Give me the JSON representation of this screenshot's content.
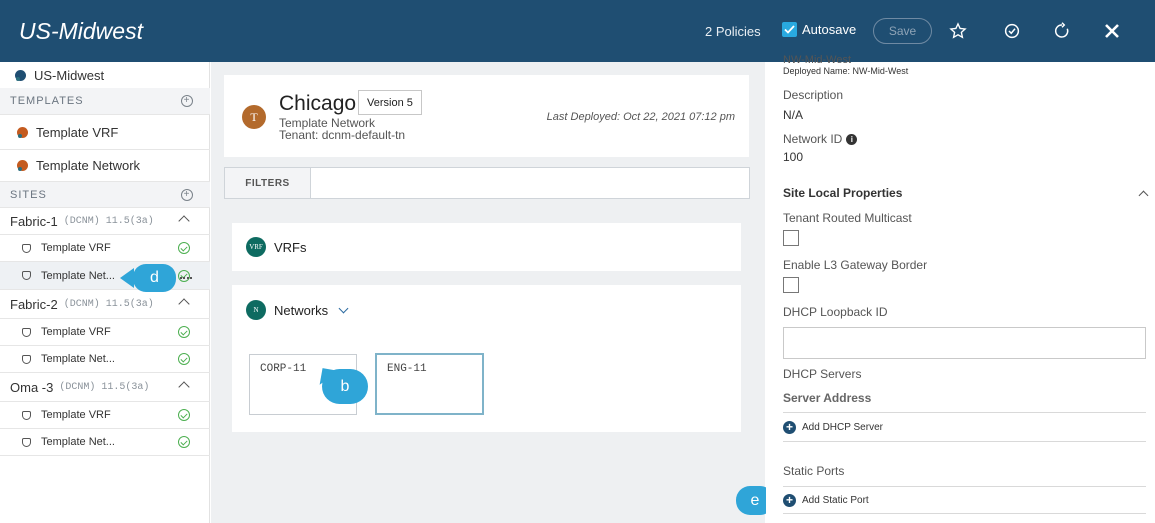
{
  "header": {
    "title": "US-Midwest",
    "policies_label": "2 Policies",
    "autosave_label": "Autosave",
    "save_label": "Save",
    "icons": [
      "checkbox-checked-icon",
      "star-icon",
      "deploy-icon",
      "refresh-icon",
      "close-icon"
    ]
  },
  "sidebar": {
    "schema_name": "US-Midwest",
    "templates_header": "TEMPLATES",
    "templates": [
      {
        "label": "Template VRF"
      },
      {
        "label": "Template Network"
      }
    ],
    "sites_header": "SITES",
    "fabrics": [
      {
        "name": "Fabric-1",
        "version": "(DCNM) 11.5(3a)",
        "items": [
          "Template VRF",
          "Template Net..."
        ]
      },
      {
        "name": "Fabric-2",
        "version": "(DCNM) 11.5(3a)",
        "items": [
          "Template VRF",
          "Template Net..."
        ]
      },
      {
        "name": "Oma -3",
        "version": "(DCNM) 11.5(3a)",
        "items": [
          "Template VRF",
          "Template Net..."
        ]
      }
    ]
  },
  "main": {
    "avatar_letter": "T",
    "template_title": "Chicago",
    "version_badge": "Version 5",
    "template_type": "Template Network",
    "tenant": "Tenant: dcnm-default-tn",
    "last_deployed": "Last Deployed: Oct 22, 2021 07:12 pm",
    "filters_label": "FILTERS",
    "vrfs_badge": "VRF",
    "vrfs_label": "VRFs",
    "networks_badge": "N",
    "networks_label": "Networks",
    "network_tiles": [
      "CORP-11",
      "ENG-11"
    ]
  },
  "callouts": {
    "b": "b",
    "d": "d",
    "e": "e"
  },
  "panel": {
    "top_name_cut": "NW-Mid-West",
    "deployed_name": "Deployed Name: NW-Mid-West",
    "description_label": "Description",
    "description_value": "N/A",
    "network_id_label": "Network ID",
    "network_id_value": "100",
    "site_local_header": "Site Local Properties",
    "tenant_routed_multicast_label": "Tenant Routed Multicast",
    "enable_l3_gw_label": "Enable L3 Gateway Border",
    "dhcp_loopback_label": "DHCP Loopback ID",
    "dhcp_servers_label": "DHCP Servers",
    "server_address_header": "Server Address",
    "add_dhcp_server": "Add DHCP Server",
    "static_ports_label": "Static Ports",
    "add_static_port": "Add Static Port"
  },
  "colors": {
    "header_bg": "#1f4e72",
    "accent": "#2fa5d8",
    "ok_green": "#4caf50",
    "badge_teal": "#0e6b61"
  }
}
